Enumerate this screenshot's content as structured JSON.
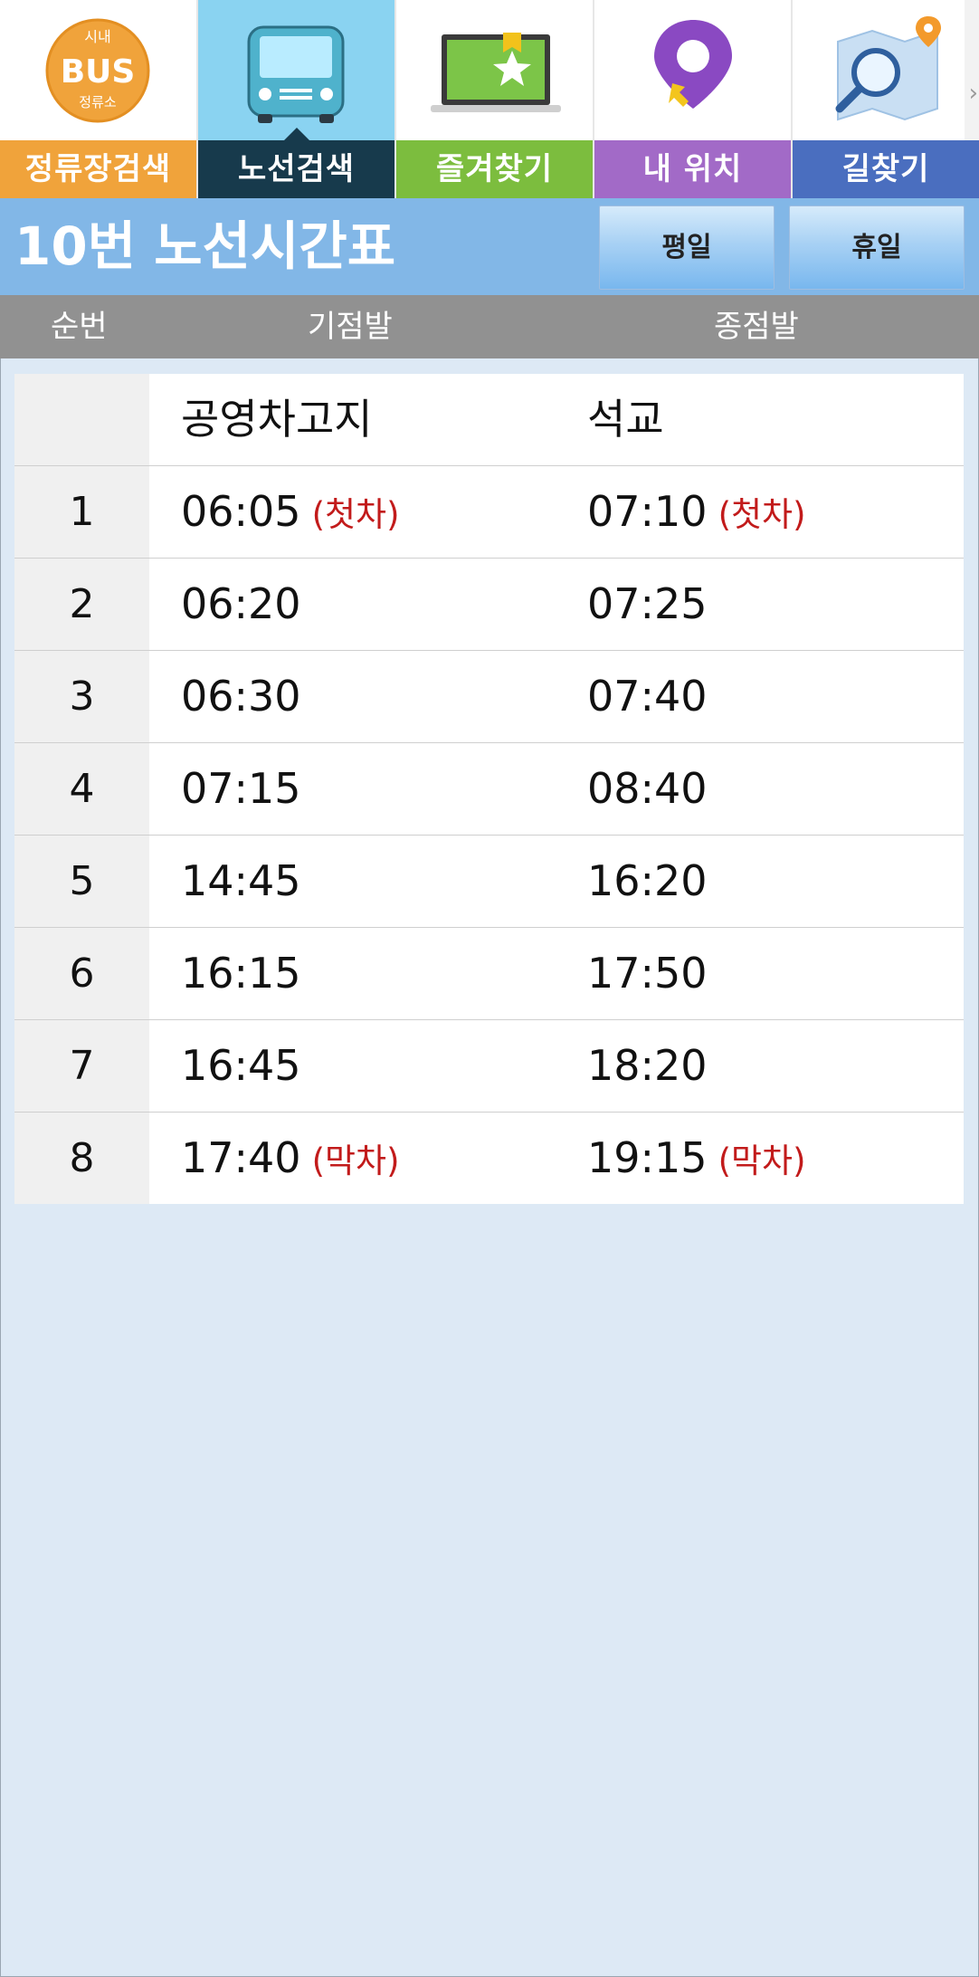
{
  "nav": {
    "items": [
      {
        "label": "정류장검색",
        "icon": "bus-stop-logo-icon",
        "logo_text_top": "시내",
        "logo_text_main": "BUS",
        "logo_text_bottom": "정류소"
      },
      {
        "label": "노선검색",
        "icon": "bus-icon"
      },
      {
        "label": "즐겨찾기",
        "icon": "bookmark-laptop-icon"
      },
      {
        "label": "내 위치",
        "icon": "location-pin-icon"
      },
      {
        "label": "길찾기",
        "icon": "map-search-icon"
      }
    ],
    "active_index": 1,
    "more_arrow": "›"
  },
  "title_bar": {
    "title": "10번 노선시간표",
    "weekday_button": "평일",
    "holiday_button": "휴일"
  },
  "columns": {
    "seq": "순번",
    "origin": "기점발",
    "terminal": "종점발"
  },
  "timetable": {
    "origin_stop": "공영차고지",
    "terminal_stop": "석교",
    "rows": [
      {
        "no": "1",
        "origin_time": "06:05",
        "origin_tag": "(첫차)",
        "terminal_time": "07:10",
        "terminal_tag": "(첫차)"
      },
      {
        "no": "2",
        "origin_time": "06:20",
        "origin_tag": "",
        "terminal_time": "07:25",
        "terminal_tag": ""
      },
      {
        "no": "3",
        "origin_time": "06:30",
        "origin_tag": "",
        "terminal_time": "07:40",
        "terminal_tag": ""
      },
      {
        "no": "4",
        "origin_time": "07:15",
        "origin_tag": "",
        "terminal_time": "08:40",
        "terminal_tag": ""
      },
      {
        "no": "5",
        "origin_time": "14:45",
        "origin_tag": "",
        "terminal_time": "16:20",
        "terminal_tag": ""
      },
      {
        "no": "6",
        "origin_time": "16:15",
        "origin_tag": "",
        "terminal_time": "17:50",
        "terminal_tag": ""
      },
      {
        "no": "7",
        "origin_time": "16:45",
        "origin_tag": "",
        "terminal_time": "18:20",
        "terminal_tag": ""
      },
      {
        "no": "8",
        "origin_time": "17:40",
        "origin_tag": "(막차)",
        "terminal_time": "19:15",
        "terminal_tag": "(막차)"
      }
    ]
  },
  "colors": {
    "nav_orange": "#f0a33b",
    "nav_dark": "#173a4c",
    "nav_green": "#7cbd3e",
    "nav_purple": "#a26ac7",
    "nav_blue": "#4a6ebf",
    "title_bar": "#82b7e7",
    "column_header": "#919191",
    "tag_red": "#c21b1b",
    "background": "#dde9f5"
  }
}
